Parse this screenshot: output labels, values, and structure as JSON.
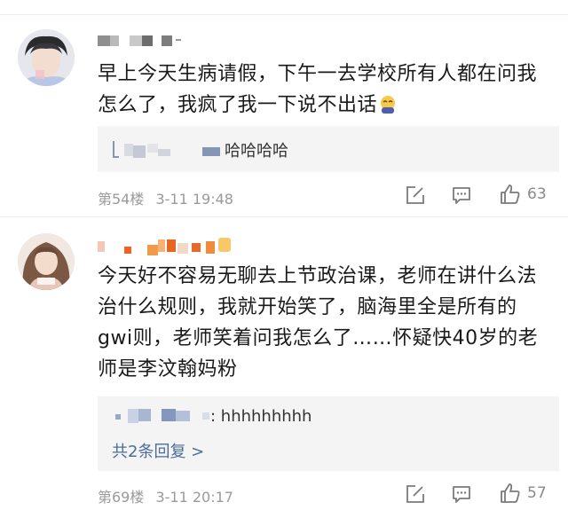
{
  "comments": [
    {
      "text_line1": "早上今天生病请假，下午一去学校所有人都在问我",
      "text_line2": "怎么了，我疯了我一下说不出话",
      "emoji": "tired-face-emoji",
      "reply": {
        "text": "哈哈哈哈"
      },
      "floor": "第54楼",
      "time": "3-11 19:48",
      "likes": "63"
    },
    {
      "text_line1": "今天好不容易无聊去上节政治课，老师在讲什么法",
      "text_line2": "治什么规则，我就开始笑了，脑海里全是所有的",
      "text_line3": "gwi则，老师笑着问我怎么了……怀疑快40岁的老",
      "text_line4": "师是李汶翰妈粉",
      "reply": {
        "text": ": hhhhhhhhh",
        "more": "共2条回复 >"
      },
      "floor": "第69楼",
      "time": "3-11 20:17",
      "likes": "57"
    }
  ],
  "colors": {
    "link": "#4a6d9a",
    "meta": "#9a9a9a",
    "reply_bg": "#f4f4f4",
    "divider": "#eeeeee"
  }
}
